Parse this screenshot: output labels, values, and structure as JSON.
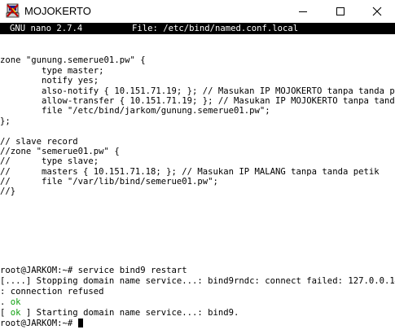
{
  "window": {
    "title": "MOJOKERTO",
    "icon": "putty-terminal-icon"
  },
  "nano": {
    "version": "GNU nano 2.7.4",
    "file": "File: /etc/bind/named.conf.local"
  },
  "editor_lines": [
    "",
    "zone \"gunung.semerue01.pw\" {",
    "        type master;",
    "        notify yes;",
    "        also-notify { 10.151.71.19; }; // Masukan IP MOJOKERTO tanpa tanda petik",
    "        allow-transfer { 10.151.71.19; }; // Masukan IP MOJOKERTO tanpa tanda p$",
    "        file \"/etc/bind/jarkom/gunung.semerue01.pw\";",
    "};",
    "",
    "// slave record",
    "//zone \"semerue01.pw\" {",
    "//      type slave;",
    "//      masters { 10.151.71.18; }; // Masukan IP MALANG tanpa tanda petik",
    "//      file \"/var/lib/bind/semerue01.pw\";",
    "//}"
  ],
  "console": {
    "command_line": "root@JARKOM:~# service bind9 restart",
    "stopping_line": "[....] Stopping domain name service...: bind9rndc: connect failed: 127.0.0.1#953",
    "refused_line": ": connection refused",
    "ok_prefix": ". ",
    "ok_word": "ok",
    "start_open": "[ ",
    "start_ok": "ok",
    "start_rest": " ] Starting domain name service...: bind9.",
    "prompt": "root@JARKOM:~# "
  },
  "colors": {
    "ok_green": "#10a010",
    "header_bg": "#000000",
    "header_fg": "#ffffff"
  }
}
